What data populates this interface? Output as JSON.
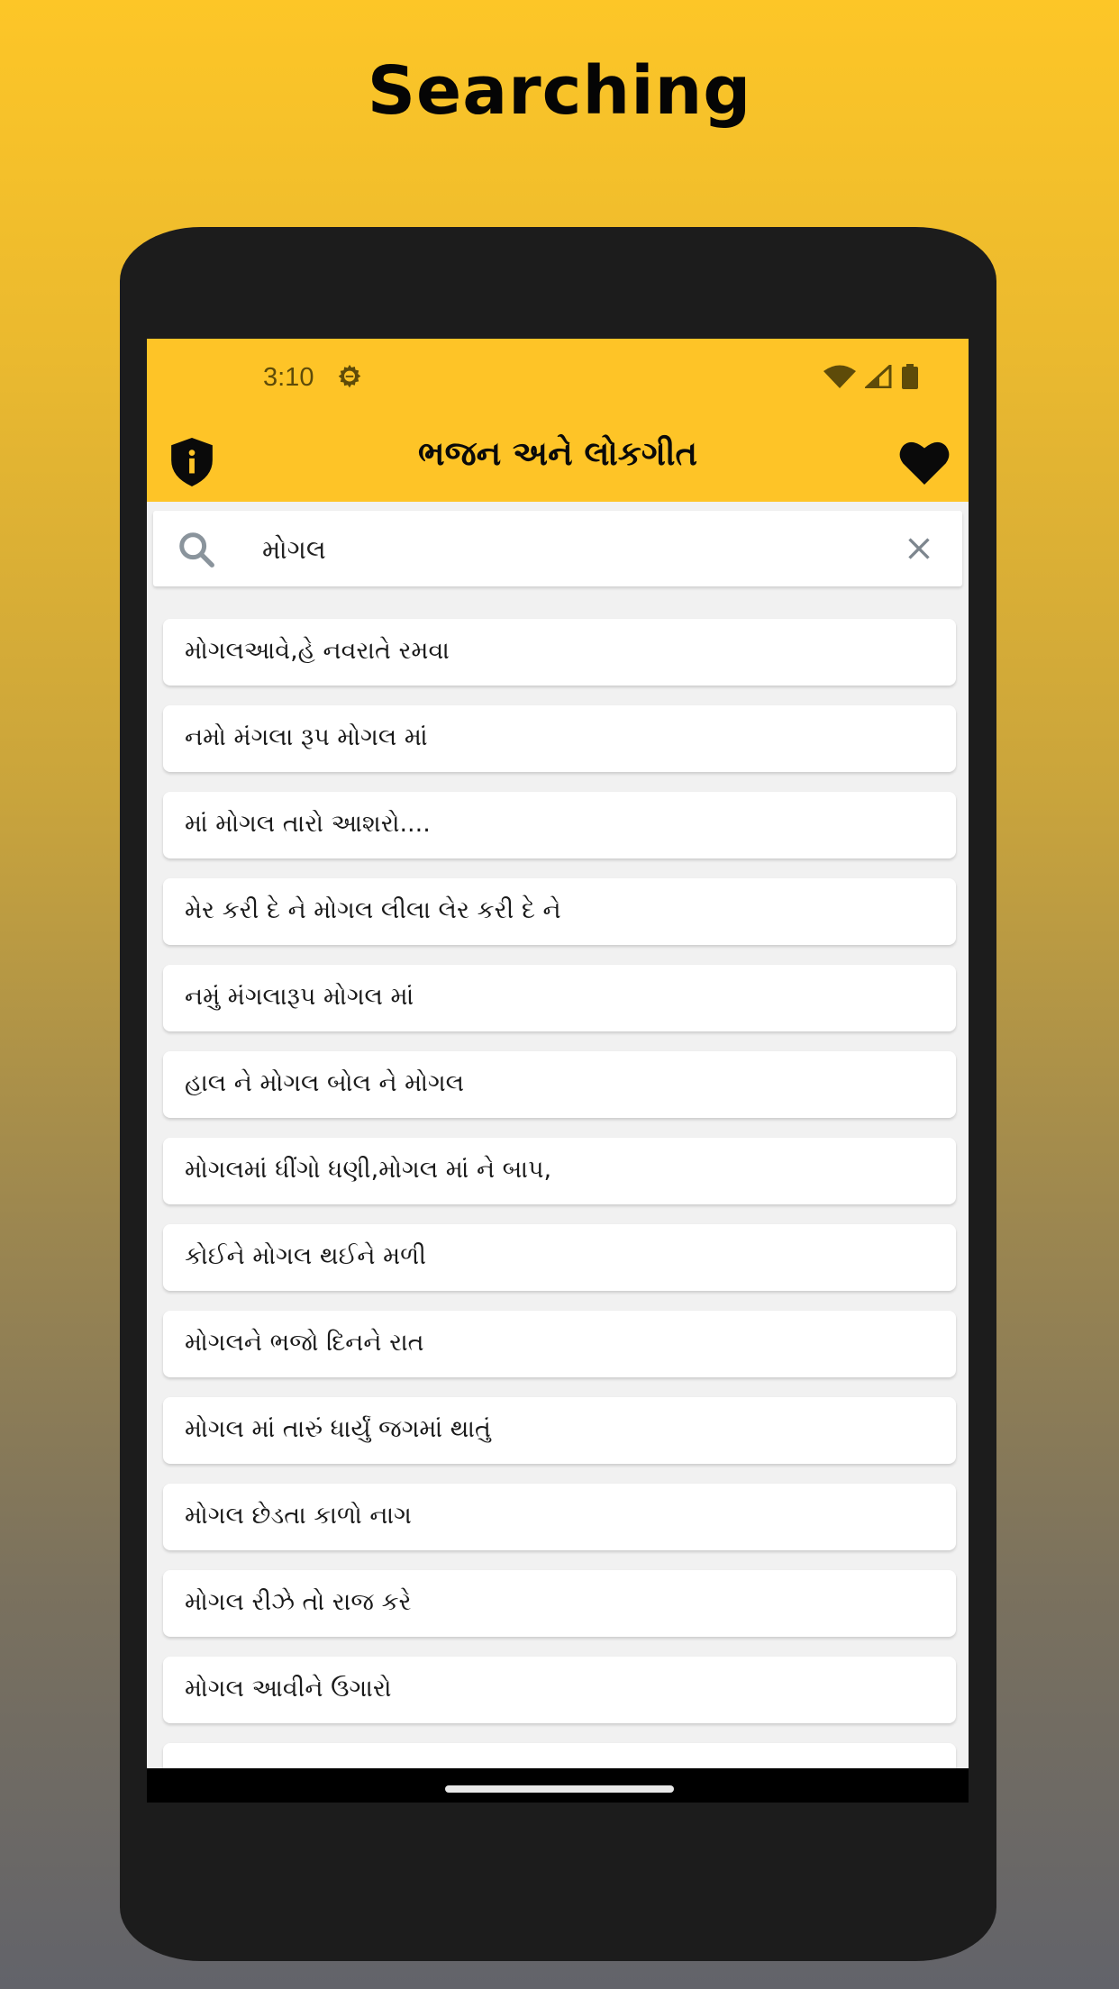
{
  "headline": "Searching",
  "colors": {
    "accent": "#fec427",
    "frame": "#1c1c1c",
    "status_icon": "#5e4b09"
  },
  "status_bar": {
    "time": "3:10",
    "icons": [
      "settings-gear-icon",
      "wifi-icon",
      "cellular-signal-icon",
      "battery-icon"
    ]
  },
  "app_bar": {
    "title": "ભજન અને લોકગીત",
    "left_icon": "shield-info-icon",
    "right_icon": "heart-icon"
  },
  "search": {
    "value": "મોગલ",
    "placeholder": "",
    "search_icon": "search-icon",
    "clear_icon": "close-icon"
  },
  "results": [
    {
      "title": "મોગલઆવે,હે નવરાતે રમવા"
    },
    {
      "title": "નમો મંગલા રૂપ મોગલ માં"
    },
    {
      "title": "માં મોગલ તારો આશરો...."
    },
    {
      "title": "મેર કરી દે ને મોગલ લીલા લેર કરી દે ને"
    },
    {
      "title": "નમું મંગલારૂપ મોગલ માં"
    },
    {
      "title": "હાલ ને મોગલ બોલ ને મોગલ"
    },
    {
      "title": "મોગલમાં ધીંગો ધણી,મોગલ માં ને બાપ,"
    },
    {
      "title": "કોઈને મોગલ થઈને મળી"
    },
    {
      "title": "મોગલને ભજો દિનને રાત"
    },
    {
      "title": "મોગલ માં તારું ધાર્યું જગમાં થાતું"
    },
    {
      "title": "મોગલ છેડતા કાળો નાગ"
    },
    {
      "title": "મોગલ રીઝે તો રાજ કરે"
    },
    {
      "title": "મોગલ આવીને ઉગારો"
    },
    {
      "title": ""
    }
  ]
}
